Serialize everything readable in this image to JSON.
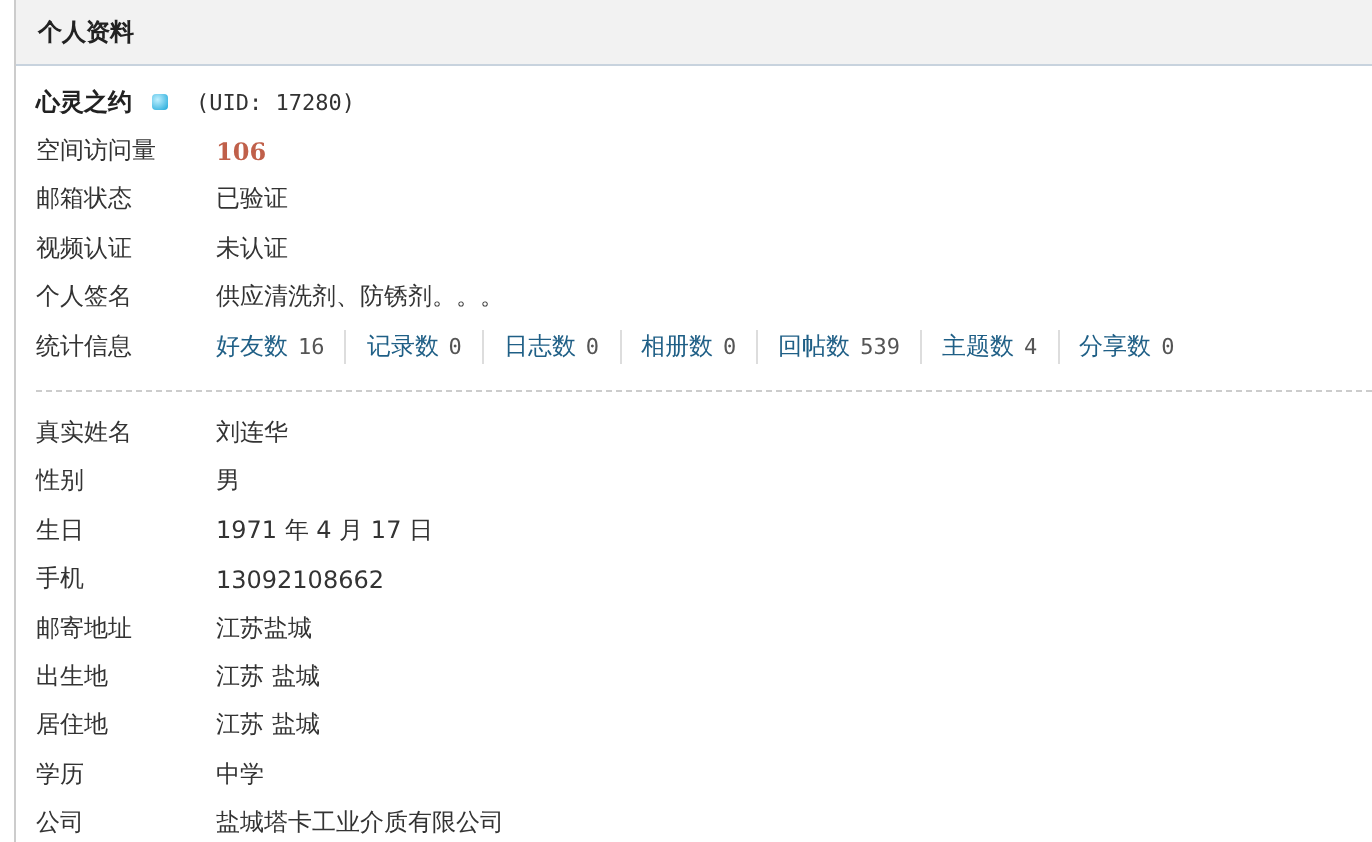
{
  "panel": {
    "title": "个人资料"
  },
  "user": {
    "name": "心灵之约",
    "uid": "(UID: 17280)"
  },
  "basic_rows": [
    {
      "kind": "visits",
      "label": "空间访问量",
      "value": "106"
    },
    {
      "kind": "text",
      "label": "邮箱状态",
      "value": "已验证"
    },
    {
      "kind": "text",
      "label": "视频认证",
      "value": "未认证"
    },
    {
      "kind": "text",
      "label": "个人签名",
      "value": "供应清洗剂、防锈剂。。。"
    }
  ],
  "stats": {
    "label": "统计信息",
    "items": [
      {
        "label": "好友数",
        "count": "16"
      },
      {
        "label": "记录数",
        "count": "0"
      },
      {
        "label": "日志数",
        "count": "0"
      },
      {
        "label": "相册数",
        "count": "0"
      },
      {
        "label": "回帖数",
        "count": "539"
      },
      {
        "label": "主题数",
        "count": "4"
      },
      {
        "label": "分享数",
        "count": "0"
      }
    ]
  },
  "profile_rows": [
    {
      "label": "真实姓名",
      "value": "刘连华"
    },
    {
      "label": "性别",
      "value": "男"
    },
    {
      "label": "生日",
      "value": "1971 年 4 月 17 日"
    },
    {
      "label": "手机",
      "value": "13092108662"
    },
    {
      "label": "邮寄地址",
      "value": "江苏盐城"
    },
    {
      "label": "出生地",
      "value": "江苏 盐城"
    },
    {
      "label": "居住地",
      "value": "江苏 盐城"
    },
    {
      "label": "学历",
      "value": "中学"
    },
    {
      "label": "公司",
      "value": "盐城塔卡工业介质有限公司"
    }
  ]
}
